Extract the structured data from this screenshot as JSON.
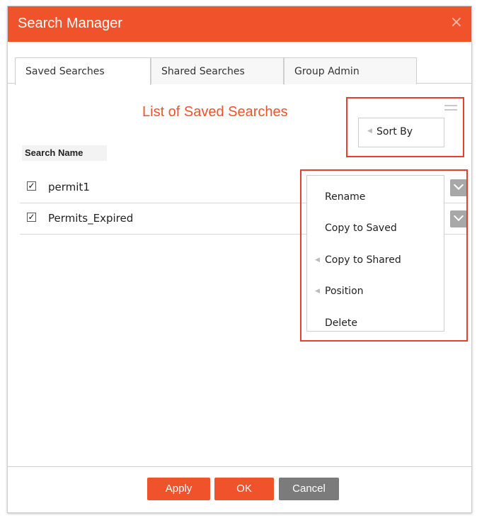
{
  "window": {
    "title": "Search Manager",
    "close_glyph": "×"
  },
  "tabs": [
    {
      "label": "Saved Searches",
      "active": true
    },
    {
      "label": "Shared Searches",
      "active": false
    },
    {
      "label": "Group Admin",
      "active": false
    }
  ],
  "main": {
    "heading": "List of Saved Searches",
    "column_header": "Search Name",
    "rows": [
      {
        "name": "permit1",
        "checked": true
      },
      {
        "name": "Permits_Expired",
        "checked": true
      }
    ],
    "check_glyph": "☑"
  },
  "sort": {
    "label": "Sort By",
    "icon": "hamburger-menu-icon"
  },
  "context_menu": {
    "items": [
      {
        "label": "Rename",
        "submenu": false
      },
      {
        "label": "Copy to Saved",
        "submenu": false
      },
      {
        "label": "Copy to Shared",
        "submenu": true
      },
      {
        "label": "Position",
        "submenu": true
      },
      {
        "label": "Delete",
        "submenu": false
      }
    ]
  },
  "footer": {
    "apply": "Apply",
    "ok": "OK",
    "cancel": "Cancel"
  },
  "colors": {
    "accent": "#f0522b",
    "highlight": "#e4412a",
    "cancel": "#7b7b7b"
  }
}
